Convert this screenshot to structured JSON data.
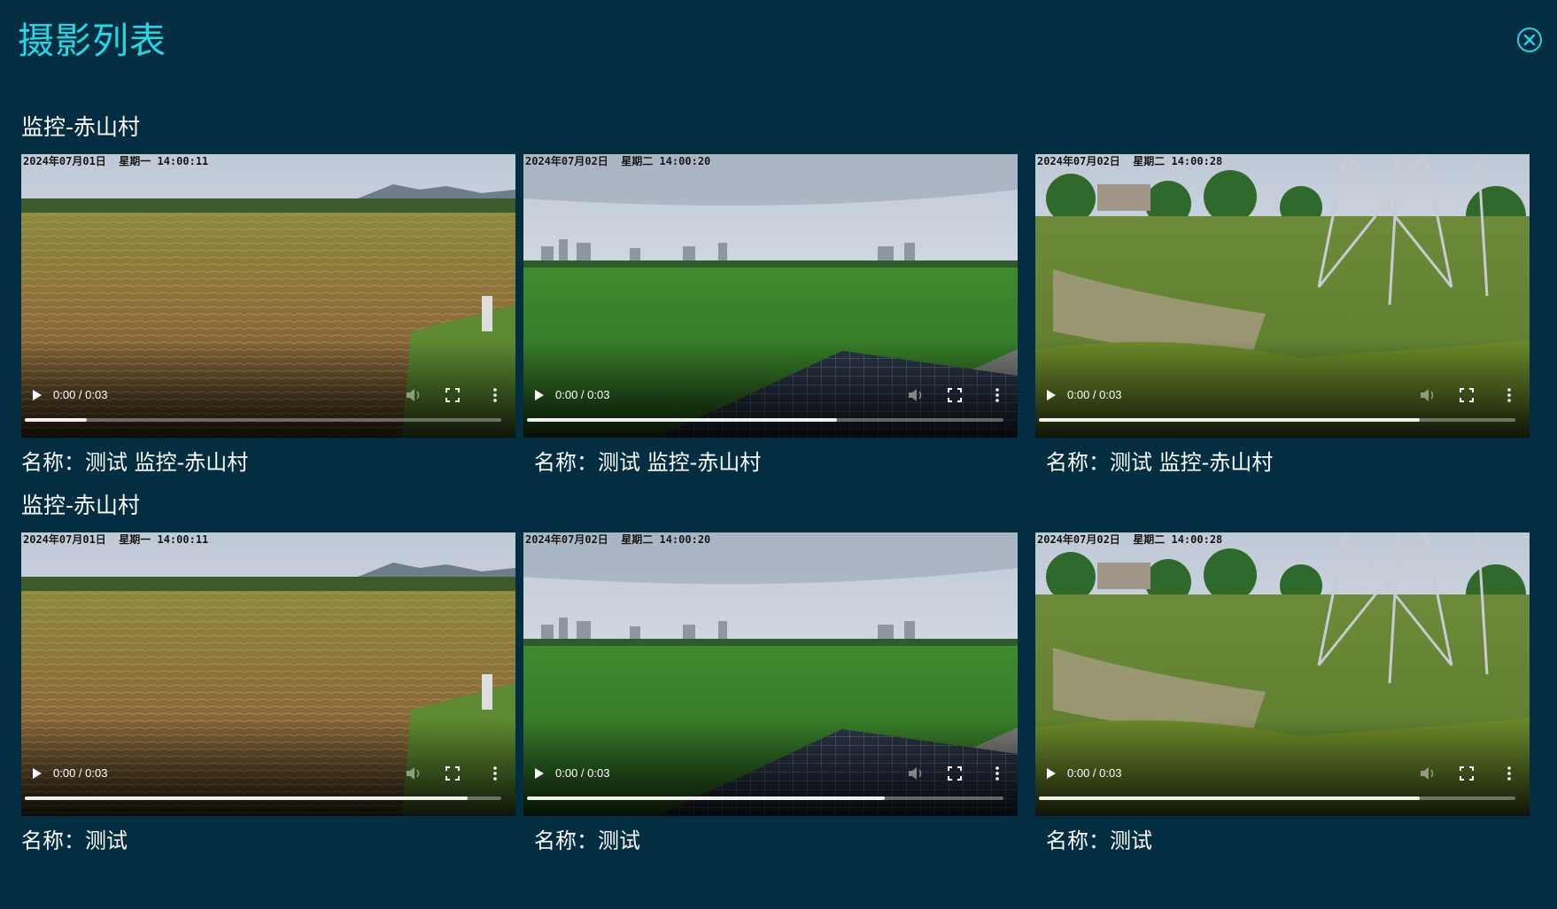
{
  "page_title": "摄影列表",
  "icons": {
    "close": "close-circle-icon",
    "play": "play-icon",
    "volume": "volume-icon",
    "fullscreen": "fullscreen-icon",
    "more": "more-vertical-icon"
  },
  "colors": {
    "background": "#032d40",
    "accent": "#22d8e6",
    "text": "#ffffff"
  },
  "groups": [
    {
      "title": "监控-赤山村",
      "videos": [
        {
          "timestamp": "2024年07月01日  星期一 14:00:11",
          "time": "0:00 / 0:03",
          "progress": 0.13,
          "name": "名称：测试 监控-赤山村",
          "scene": "dry-field"
        },
        {
          "timestamp": "2024年07月02日  星期二 14:00:20",
          "time": "0:00 / 0:03",
          "progress": 0.65,
          "name": "名称：测试 监控-赤山村",
          "scene": "green-field"
        },
        {
          "timestamp": "2024年07月02日  星期二 14:00:28",
          "time": "0:00 / 0:03",
          "progress": 0.8,
          "name": "名称：测试 监控-赤山村",
          "scene": "pylon-field"
        }
      ]
    },
    {
      "title": "监控-赤山村",
      "videos": [
        {
          "timestamp": "2024年07月01日  星期一 14:00:11",
          "time": "0:00 / 0:03",
          "progress": 0.93,
          "name": "名称：测试",
          "scene": "dry-field"
        },
        {
          "timestamp": "2024年07月02日  星期二 14:00:20",
          "time": "0:00 / 0:03",
          "progress": 0.75,
          "name": "名称：测试",
          "scene": "green-field"
        },
        {
          "timestamp": "2024年07月02日  星期二 14:00:28",
          "time": "0:00 / 0:03",
          "progress": 0.8,
          "name": "名称：测试",
          "scene": "pylon-field"
        }
      ]
    }
  ]
}
